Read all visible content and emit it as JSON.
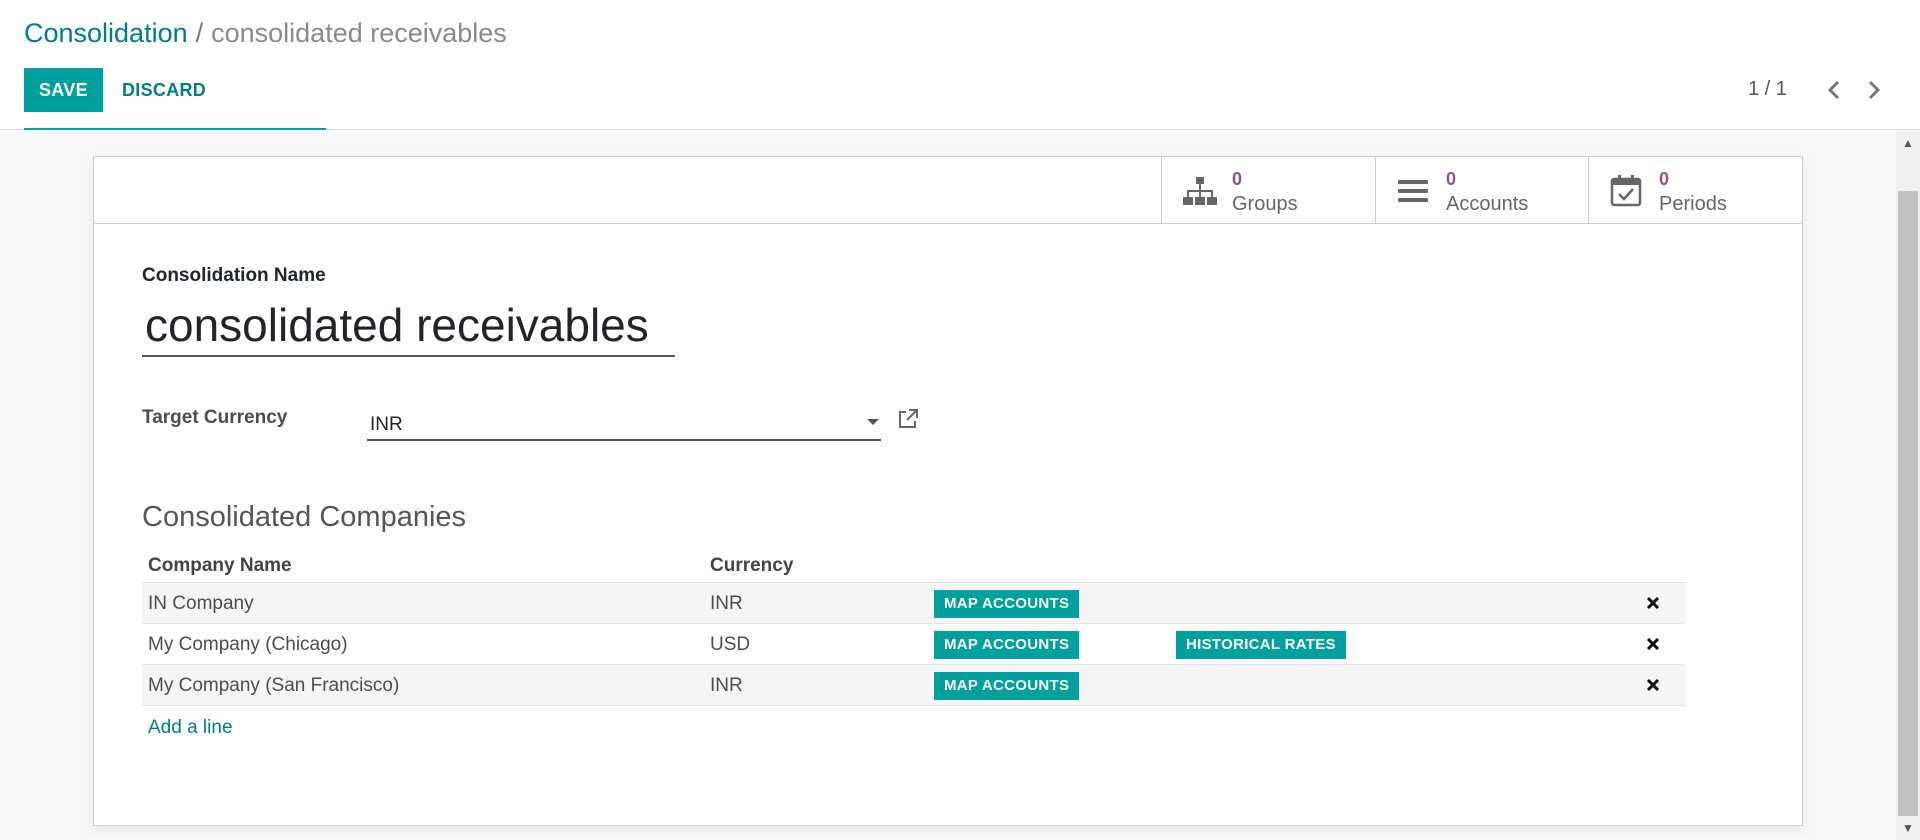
{
  "breadcrumb": {
    "parent": "Consolidation",
    "separator": "/",
    "current": "consolidated receivables"
  },
  "toolbar": {
    "save_label": "SAVE",
    "discard_label": "DISCARD"
  },
  "pager": {
    "value": "1 / 1"
  },
  "stat_buttons": [
    {
      "value": "0",
      "label": "Groups",
      "icon": "sitemap-icon"
    },
    {
      "value": "0",
      "label": "Accounts",
      "icon": "list-icon"
    },
    {
      "value": "0",
      "label": "Periods",
      "icon": "calendar-check-icon"
    }
  ],
  "form": {
    "name_label": "Consolidation Name",
    "name_value": "consolidated receivables",
    "currency_label": "Target Currency",
    "currency_value": "INR"
  },
  "companies": {
    "title": "Consolidated Companies",
    "columns": [
      "Company Name",
      "Currency"
    ],
    "rows": [
      {
        "name": "IN Company",
        "currency": "INR",
        "actions": [
          "MAP ACCOUNTS"
        ]
      },
      {
        "name": "My Company (Chicago)",
        "currency": "USD",
        "actions": [
          "MAP ACCOUNTS",
          "HISTORICAL RATES"
        ]
      },
      {
        "name": "My Company (San Francisco)",
        "currency": "INR",
        "actions": [
          "MAP ACCOUNTS"
        ]
      }
    ],
    "add_line": "Add a line"
  },
  "colors": {
    "primary": "#00a09d",
    "link": "#017e84",
    "stat_value": "#875a7b"
  }
}
